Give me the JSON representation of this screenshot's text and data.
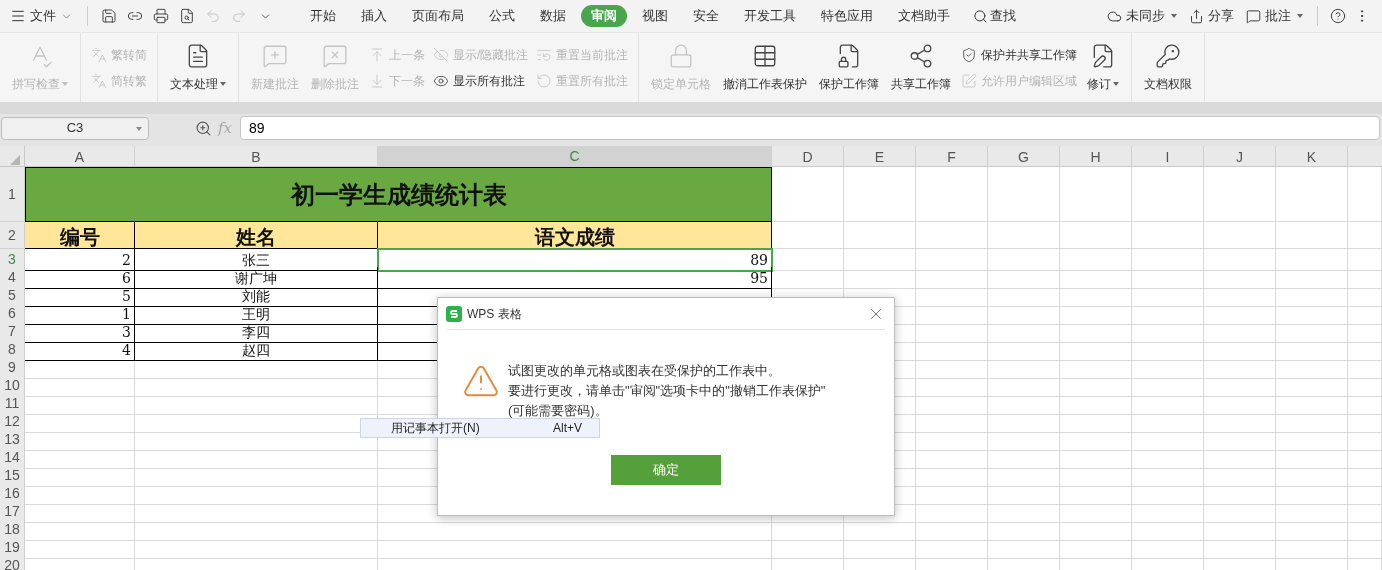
{
  "menubar": {
    "file_label": "文件",
    "quick_tools": [
      {
        "disabled": false
      },
      {
        "disabled": false
      },
      {
        "disabled": false
      },
      {
        "disabled": false
      },
      {
        "disabled": true
      },
      {
        "disabled": true
      },
      {
        "disabled": false
      }
    ],
    "tabs": [
      {
        "label": "开始",
        "selected": false
      },
      {
        "label": "插入",
        "selected": false
      },
      {
        "label": "页面布局",
        "selected": false
      },
      {
        "label": "公式",
        "selected": false
      },
      {
        "label": "数据",
        "selected": false
      },
      {
        "label": "审阅",
        "selected": true
      },
      {
        "label": "视图",
        "selected": false
      },
      {
        "label": "安全",
        "selected": false
      },
      {
        "label": "开发工具",
        "selected": false
      },
      {
        "label": "特色应用",
        "selected": false
      },
      {
        "label": "文档助手",
        "selected": false
      }
    ],
    "search_label": "查找",
    "right_items": [
      {
        "label": "未同步",
        "dropdown": true
      },
      {
        "label": "分享",
        "dropdown": false
      },
      {
        "label": "批注",
        "dropdown": true
      }
    ]
  },
  "ribbon": {
    "groups": [
      {
        "items": [
          {
            "kind": "large",
            "label": "拼写检查",
            "disabled": true,
            "dropdown": true
          }
        ]
      },
      {
        "items": [
          {
            "kind": "stack",
            "items": [
              {
                "label": "繁转简",
                "disabled": true
              },
              {
                "label": "简转繁",
                "disabled": true
              }
            ]
          }
        ]
      },
      {
        "items": [
          {
            "kind": "large",
            "label": "文本处理",
            "disabled": false,
            "dropdown": true
          }
        ]
      },
      {
        "items": [
          {
            "kind": "large",
            "label": "新建批注",
            "disabled": true,
            "dropdown": false
          },
          {
            "kind": "large",
            "label": "删除批注",
            "disabled": true,
            "dropdown": false
          },
          {
            "kind": "stack",
            "items": [
              {
                "label": "上一条",
                "disabled": true
              },
              {
                "label": "下一条",
                "disabled": true
              }
            ]
          },
          {
            "kind": "stack",
            "items": [
              {
                "label": "显示/隐藏批注",
                "disabled": true
              },
              {
                "label": "显示所有批注",
                "disabled": false
              }
            ]
          },
          {
            "kind": "stack",
            "items": [
              {
                "label": "重置当前批注",
                "disabled": true
              },
              {
                "label": "重置所有批注",
                "disabled": true
              }
            ]
          }
        ]
      },
      {
        "items": [
          {
            "kind": "large",
            "label": "锁定单元格",
            "disabled": true,
            "dropdown": false
          },
          {
            "kind": "large",
            "label": "撤消工作表保护",
            "disabled": false,
            "dropdown": false
          },
          {
            "kind": "large",
            "label": "保护工作簿",
            "disabled": false,
            "dropdown": false
          },
          {
            "kind": "large",
            "label": "共享工作簿",
            "disabled": false,
            "dropdown": false
          },
          {
            "kind": "stack",
            "items": [
              {
                "label": "保护并共享工作簿",
                "disabled": false
              },
              {
                "label": "允许用户编辑区域",
                "disabled": true
              }
            ]
          },
          {
            "kind": "large",
            "label": "修订",
            "disabled": false,
            "dropdown": true
          }
        ]
      },
      {
        "items": [
          {
            "kind": "large",
            "label": "文档权限",
            "disabled": false,
            "dropdown": false
          }
        ]
      }
    ]
  },
  "formula_bar": {
    "name_box": "C3",
    "fx_label": "fx",
    "value": "89"
  },
  "sheet": {
    "columns": [
      {
        "label": "A",
        "selected": false
      },
      {
        "label": "B",
        "selected": false
      },
      {
        "label": "C",
        "selected": true
      },
      {
        "label": "D",
        "selected": false
      },
      {
        "label": "E",
        "selected": false
      },
      {
        "label": "F",
        "selected": false
      },
      {
        "label": "G",
        "selected": false
      },
      {
        "label": "H",
        "selected": false
      },
      {
        "label": "I",
        "selected": false
      },
      {
        "label": "J",
        "selected": false
      },
      {
        "label": "K",
        "selected": false
      }
    ],
    "rows": [
      {
        "label": "1",
        "selected": false,
        "kind": "title",
        "cells": [
          "初一学生成绩统计表"
        ]
      },
      {
        "label": "2",
        "selected": false,
        "kind": "header",
        "cells": [
          "编号",
          "姓名",
          "语文成绩"
        ]
      },
      {
        "label": "3",
        "selected": true,
        "kind": "data",
        "cells": [
          "2",
          "张三",
          "89"
        ]
      },
      {
        "label": "4",
        "selected": false,
        "kind": "data",
        "cells": [
          "6",
          "谢广坤",
          "95"
        ]
      },
      {
        "label": "5",
        "selected": false,
        "kind": "data",
        "cells": [
          "5",
          "刘能"
        ]
      },
      {
        "label": "6",
        "selected": false,
        "kind": "data",
        "cells": [
          "1",
          "王明"
        ]
      },
      {
        "label": "7",
        "selected": false,
        "kind": "data",
        "cells": [
          "3",
          "李四"
        ]
      },
      {
        "label": "8",
        "selected": false,
        "kind": "data",
        "cells": [
          "4",
          "赵四"
        ]
      },
      {
        "label": "9",
        "selected": false,
        "kind": "empty"
      },
      {
        "label": "10",
        "selected": false,
        "kind": "empty"
      },
      {
        "label": "11",
        "selected": false,
        "kind": "empty"
      },
      {
        "label": "12",
        "selected": false,
        "kind": "empty"
      },
      {
        "label": "13",
        "selected": false,
        "kind": "empty"
      },
      {
        "label": "14",
        "selected": false,
        "kind": "empty"
      },
      {
        "label": "15",
        "selected": false,
        "kind": "empty"
      },
      {
        "label": "16",
        "selected": false,
        "kind": "empty"
      },
      {
        "label": "17",
        "selected": false,
        "kind": "empty"
      },
      {
        "label": "18",
        "selected": false,
        "kind": "empty"
      },
      {
        "label": "19",
        "selected": false,
        "kind": "empty"
      },
      {
        "label": "20",
        "selected": false,
        "kind": "empty"
      }
    ]
  },
  "dialog": {
    "title": "WPS 表格",
    "message": [
      "试图更改的单元格或图表在受保护的工作表中。",
      "要进行更改，请单击\"审阅\"选项卡中的\"撤销工作表保护\"(可能需要密码)。"
    ],
    "button": "确定"
  },
  "context_menu": {
    "label": "用记事本打开(N)",
    "shortcut": "Alt+V"
  }
}
